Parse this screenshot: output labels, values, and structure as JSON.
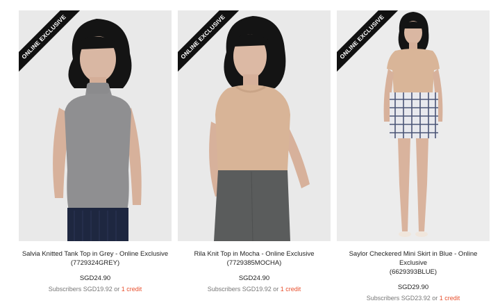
{
  "ribbon_text": "ONLINE EXCLUSIVE",
  "or_word": "or",
  "products": [
    {
      "name": "Salvia Knitted Tank Top in Grey - Online Exclusive",
      "sku": "(7729324GREY)",
      "price": "SGD24.90",
      "subscriber_price": "Subscribers SGD19.92",
      "credit": "1 credit"
    },
    {
      "name": "Rila Knit Top in Mocha - Online Exclusive",
      "sku": "(7729385MOCHA)",
      "price": "SGD24.90",
      "subscriber_price": "Subscribers SGD19.92",
      "credit": "1 credit"
    },
    {
      "name": "Saylor Checkered Mini Skirt in Blue - Online Exclusive",
      "sku": "(6629393BLUE)",
      "price": "SGD29.90",
      "subscriber_price": "Subscribers SGD23.92",
      "credit": "1 credit"
    }
  ],
  "colors": {
    "credit_accent": "#e8512f",
    "ribbon_bg": "#111111",
    "photo_bg": "#e9e9e9"
  }
}
